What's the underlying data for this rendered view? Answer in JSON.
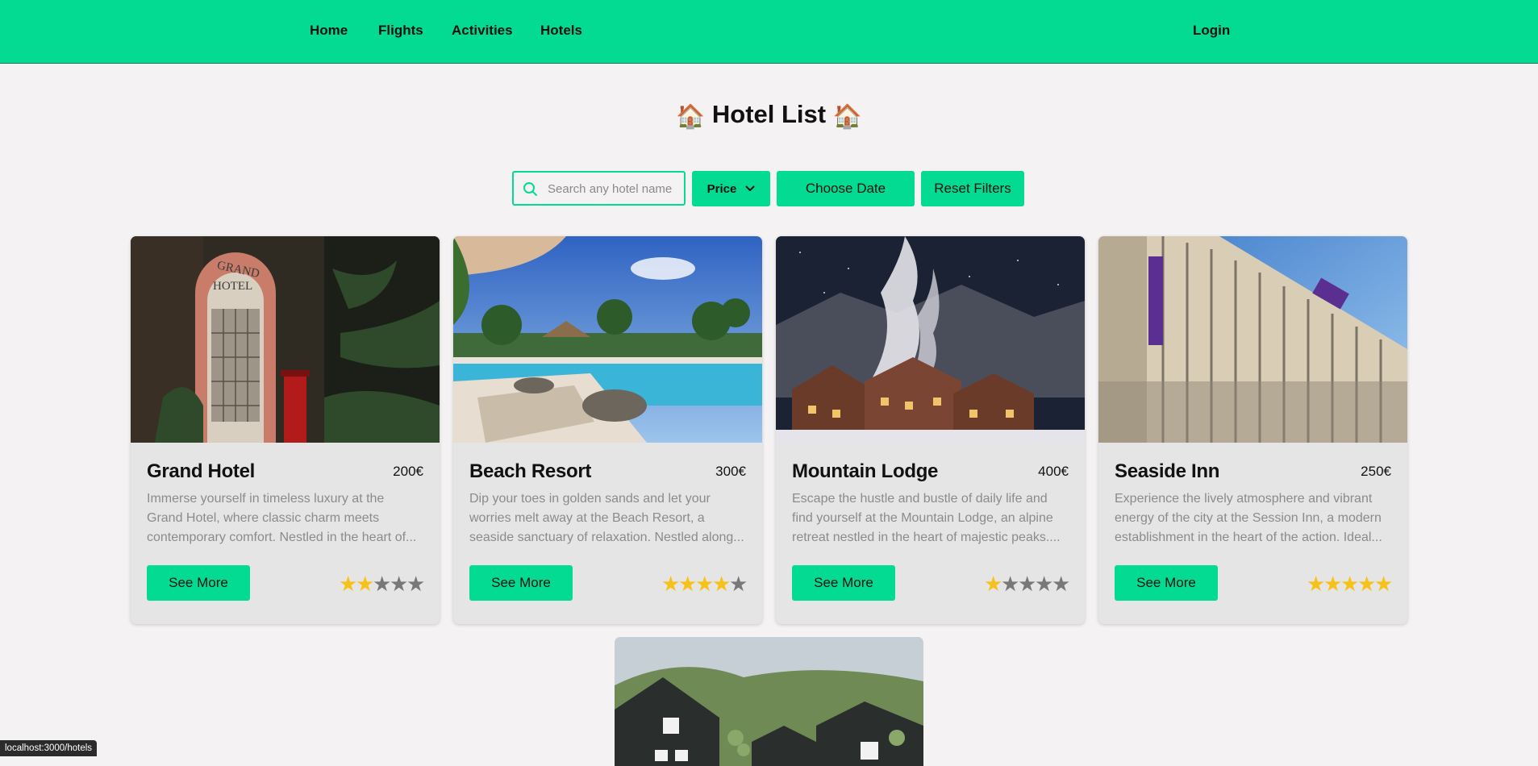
{
  "nav": {
    "links": [
      "Home",
      "Flights",
      "Activities",
      "Hotels"
    ],
    "login": "Login",
    "accent_color": "#03db93"
  },
  "page": {
    "title_emoji": "🏠",
    "title": "Hotel List"
  },
  "filters": {
    "search_placeholder": "Search any hotel name",
    "search_value": "",
    "price_label": "Price",
    "date_label": "Choose Date",
    "reset_label": "Reset Filters"
  },
  "hotels": [
    {
      "name": "Grand Hotel",
      "price": "200€",
      "description": "Immerse yourself in timeless luxury at the Grand Hotel, where classic charm meets contemporary comfort. Nestled in the heart of...",
      "rating": 2,
      "button": "See More"
    },
    {
      "name": "Beach Resort",
      "price": "300€",
      "description": "Dip your toes in golden sands and let your worries melt away at the Beach Resort, a seaside sanctuary of relaxation. Nestled along...",
      "rating": 4,
      "button": "See More"
    },
    {
      "name": "Mountain Lodge",
      "price": "400€",
      "description": "Escape the hustle and bustle of daily life and find yourself at the Mountain Lodge, an alpine retreat nestled in the heart of majestic peaks....",
      "rating": 1,
      "button": "See More"
    },
    {
      "name": "Seaside Inn",
      "price": "250€",
      "description": "Experience the lively atmosphere and vibrant energy of the city at the Session Inn, a modern establishment in the heart of the action. Ideal...",
      "rating": 5,
      "button": "See More"
    }
  ],
  "rating_max": 5,
  "status_bar": "localhost:3000/hotels"
}
